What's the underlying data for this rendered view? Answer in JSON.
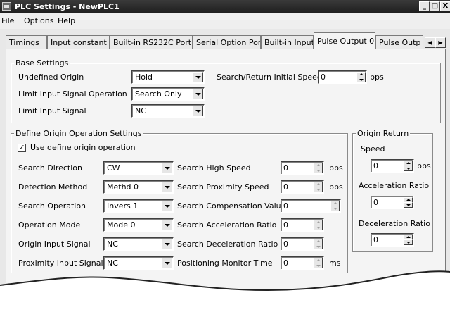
{
  "window": {
    "title": "PLC Settings - NewPLC1",
    "controls": {
      "minimize": "_",
      "maximize": "□",
      "close": "X"
    }
  },
  "menu": {
    "items": [
      "File",
      "Options",
      "Help"
    ]
  },
  "tabs": {
    "items": [
      "Timings",
      "Input constant",
      "Built-in RS232C Port",
      "Serial Option Port",
      "Built-in Input",
      "Pulse Output 0",
      "Pulse Outp"
    ],
    "active": "Pulse Output 0"
  },
  "base_settings": {
    "legend": "Base Settings",
    "undefined_origin": {
      "label": "Undefined Origin",
      "value": "Hold"
    },
    "limit_input_signal_operation": {
      "label": "Limit Input Signal Operation",
      "value": "Search Only"
    },
    "limit_input_signal": {
      "label": "Limit Input Signal",
      "value": "NC"
    },
    "search_return_initial_speed": {
      "label": "Search/Return Initial Speed",
      "value": "0",
      "unit": "pps"
    }
  },
  "define_origin": {
    "legend": "Define Origin Operation Settings",
    "use_checkbox": {
      "label": "Use define origin operation",
      "checked": true,
      "mark": "✓"
    },
    "left_fields": [
      {
        "label": "Search Direction",
        "value": "CW"
      },
      {
        "label": "Detection Method",
        "value": "Methd 0"
      },
      {
        "label": "Search Operation",
        "value": "Invers 1"
      },
      {
        "label": "Operation Mode",
        "value": "Mode 0"
      },
      {
        "label": "Origin Input Signal",
        "value": "NC"
      },
      {
        "label": "Proximity Input Signal",
        "value": "NC"
      }
    ],
    "right_fields": [
      {
        "label": "Search High Speed",
        "value": "0",
        "unit": "pps"
      },
      {
        "label": "Search Proximity Speed",
        "value": "0",
        "unit": "pps"
      },
      {
        "label": "Search Compensation Value",
        "value": "0",
        "unit": ""
      },
      {
        "label": "Search Acceleration Ratio",
        "value": "0",
        "unit": ""
      },
      {
        "label": "Search Deceleration Ratio",
        "value": "0",
        "unit": ""
      },
      {
        "label": "Positioning Monitor Time",
        "value": "0",
        "unit": "ms"
      }
    ]
  },
  "origin_return": {
    "legend": "Origin Return",
    "speed": {
      "label": "Speed",
      "value": "0",
      "unit": "pps"
    },
    "acceleration_ratio": {
      "label": "Acceleration Ratio",
      "value": "0"
    },
    "deceleration_ratio": {
      "label": "Deceleration Ratio",
      "value": "0"
    }
  }
}
